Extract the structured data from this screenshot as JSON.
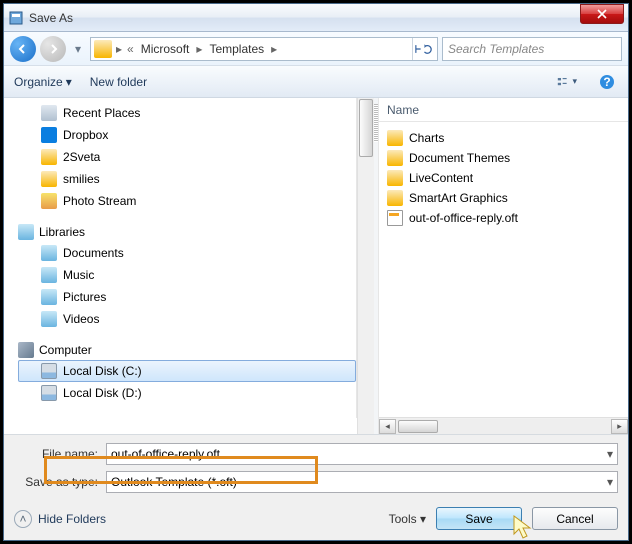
{
  "window": {
    "title": "Save As"
  },
  "nav": {
    "crumbs": [
      "Microsoft",
      "Templates"
    ],
    "search_placeholder": "Search Templates"
  },
  "toolbar": {
    "organize": "Organize",
    "newfolder": "New folder"
  },
  "tree": {
    "group1": [
      {
        "name": "Recent Places",
        "icon": "recent"
      },
      {
        "name": "Dropbox",
        "icon": "dropbox"
      },
      {
        "name": "2Sveta",
        "icon": "folder"
      },
      {
        "name": "smilies",
        "icon": "folder"
      },
      {
        "name": "Photo Stream",
        "icon": "photo"
      }
    ],
    "libraries_label": "Libraries",
    "libraries": [
      {
        "name": "Documents"
      },
      {
        "name": "Music"
      },
      {
        "name": "Pictures"
      },
      {
        "name": "Videos"
      }
    ],
    "computer_label": "Computer",
    "computer": [
      {
        "name": "Local Disk (C:)",
        "selected": true
      },
      {
        "name": "Local Disk (D:)",
        "selected": false
      }
    ]
  },
  "right": {
    "header": "Name",
    "items": [
      {
        "name": "Charts",
        "type": "folder"
      },
      {
        "name": "Document Themes",
        "type": "folder"
      },
      {
        "name": "LiveContent",
        "type": "folder"
      },
      {
        "name": "SmartArt Graphics",
        "type": "folder"
      },
      {
        "name": "out-of-office-reply.oft",
        "type": "oft"
      }
    ]
  },
  "fields": {
    "filename_label": "File name:",
    "filename_value": "out-of-office-reply.oft",
    "savetype_label": "Save as type:",
    "savetype_value": "Outlook Template (*.oft)"
  },
  "footer": {
    "hide": "Hide Folders",
    "tools": "Tools",
    "save": "Save",
    "cancel": "Cancel"
  }
}
